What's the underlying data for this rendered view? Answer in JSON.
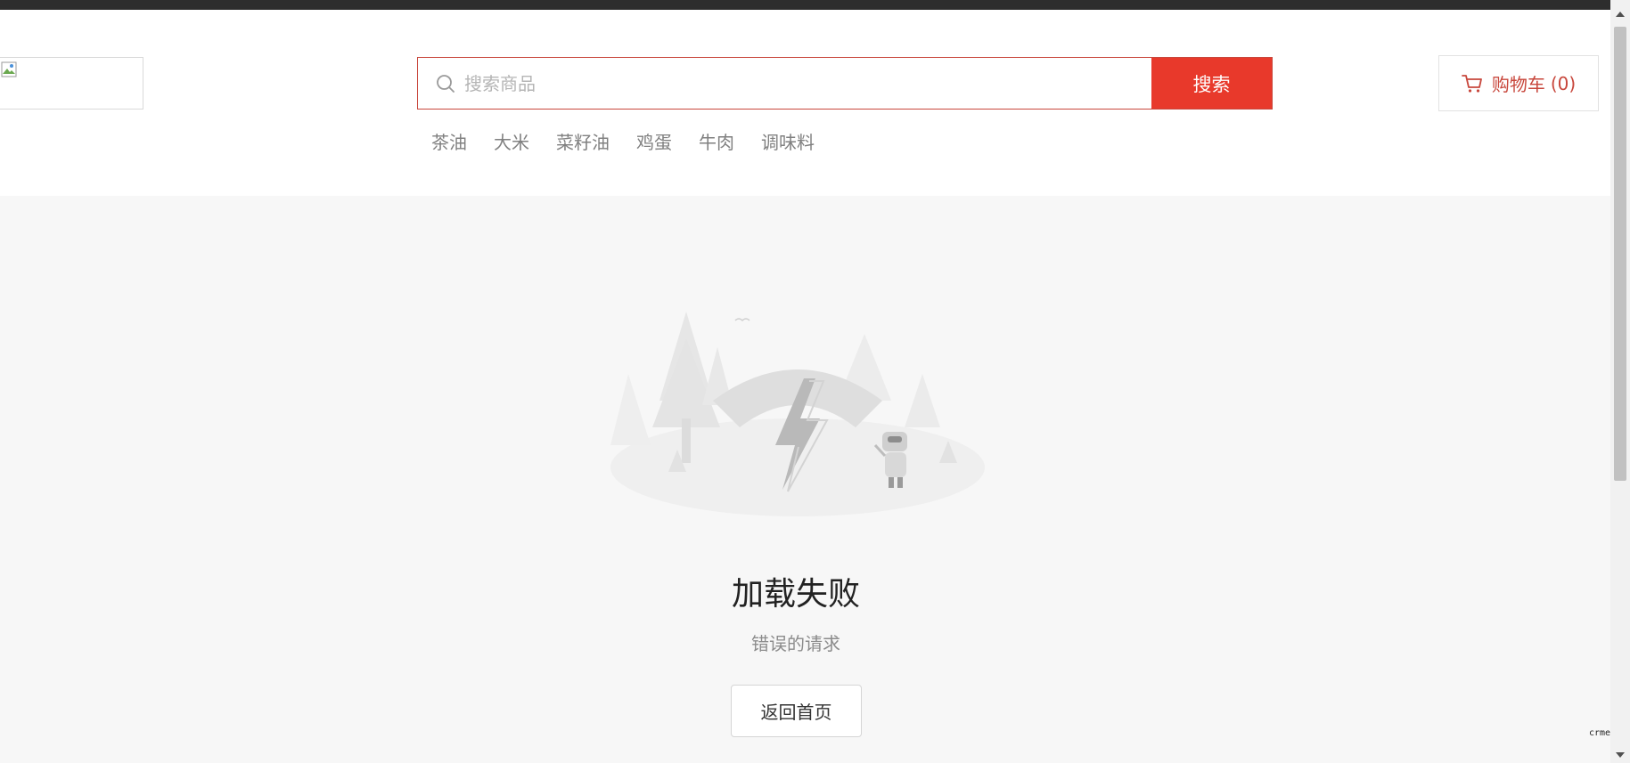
{
  "search": {
    "placeholder": "搜索商品",
    "button_label": "搜索"
  },
  "hot_words": [
    "茶油",
    "大米",
    "菜籽油",
    "鸡蛋",
    "牛肉",
    "调味料"
  ],
  "cart": {
    "label": "购物车",
    "count_display": "(0)"
  },
  "error": {
    "title": "加载失败",
    "message": "错误的请求",
    "home_button": "返回首页"
  },
  "corner_mark": "crmeb",
  "colors": {
    "accent": "#e8392b",
    "topbar": "#2d2d2d",
    "page_bg": "#f7f7f7"
  },
  "icons": {
    "search": "search-icon",
    "cart": "cart-icon",
    "logo": "broken-image-icon"
  }
}
